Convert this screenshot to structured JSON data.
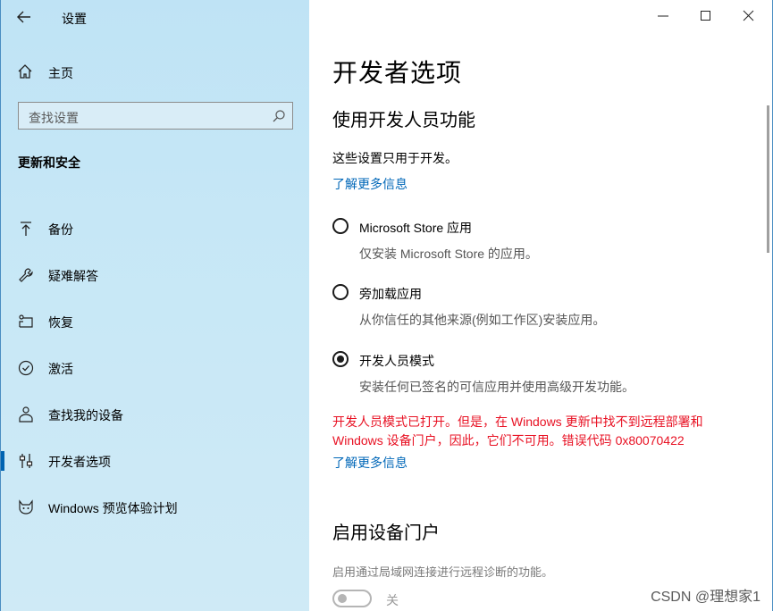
{
  "app": {
    "title": "设置"
  },
  "sidebar": {
    "home_label": "主页",
    "search_placeholder": "查找设置",
    "section_title": "更新和安全",
    "items": [
      {
        "label": "备份",
        "icon": "backup-arrow-icon"
      },
      {
        "label": "疑难解答",
        "icon": "wrench-icon"
      },
      {
        "label": "恢复",
        "icon": "recovery-icon"
      },
      {
        "label": "激活",
        "icon": "check-circle-icon"
      },
      {
        "label": "查找我的设备",
        "icon": "person-location-icon"
      },
      {
        "label": "开发者选项",
        "icon": "developer-sliders-icon",
        "active": true
      },
      {
        "label": "Windows 预览体验计划",
        "icon": "insider-cat-icon"
      }
    ]
  },
  "main": {
    "page_title": "开发者选项",
    "section_title": "使用开发人员功能",
    "intro": "这些设置只用于开发。",
    "learn_more_1": "了解更多信息",
    "options": [
      {
        "label": "Microsoft Store 应用",
        "desc": "仅安装 Microsoft Store 的应用。",
        "checked": false
      },
      {
        "label": "旁加载应用",
        "desc": "从你信任的其他来源(例如工作区)安装应用。",
        "checked": false
      },
      {
        "label": "开发人员模式",
        "desc": "安装任何已签名的可信应用并使用高级开发功能。",
        "checked": true
      }
    ],
    "error_message": "开发人员模式已打开。但是，在 Windows 更新中找不到远程部署和 Windows 设备门户，因此，它们不可用。错误代码 0x80070422",
    "learn_more_2": "了解更多信息",
    "portal_title": "启用设备门户",
    "portal_desc": "启用通过局域网连接进行远程诊断的功能。",
    "toggle_label": "关"
  },
  "watermark": "CSDN @理想家1",
  "colors": {
    "link": "#0067b8",
    "error": "#e81123",
    "accent": "#0063b1"
  }
}
